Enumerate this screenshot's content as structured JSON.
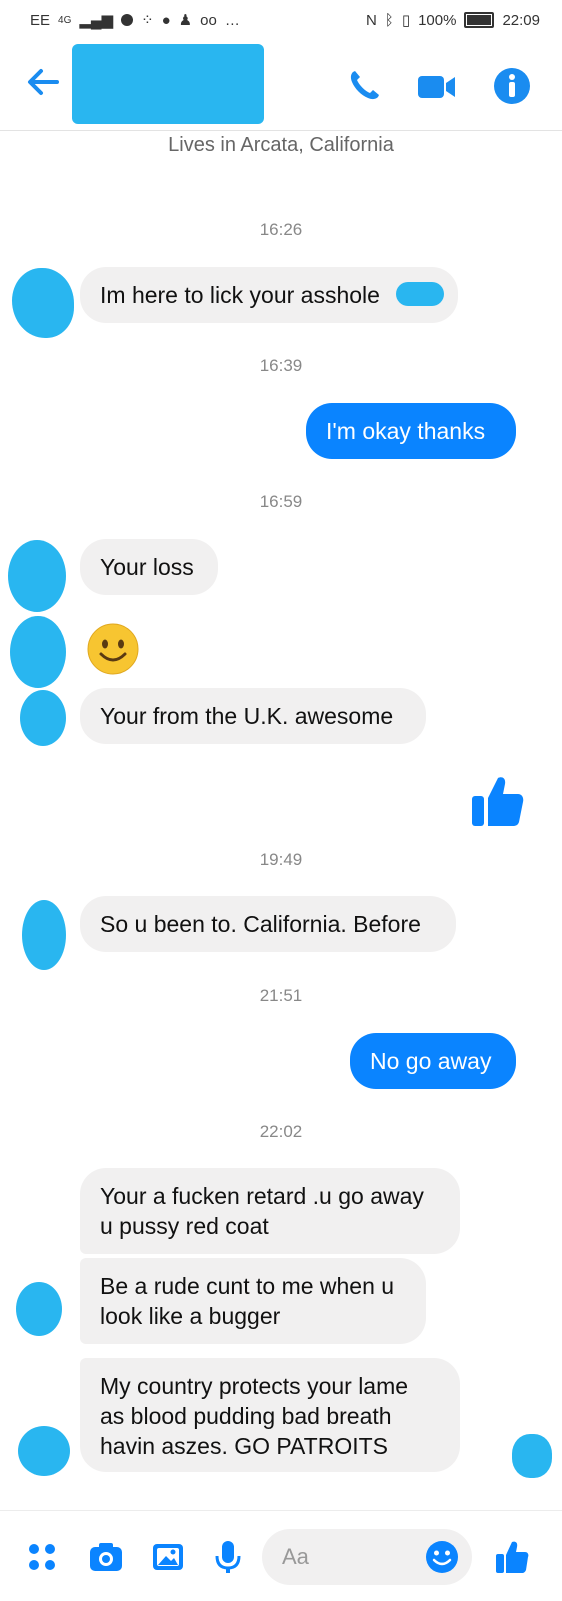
{
  "status_bar": {
    "carrier": "EE",
    "network": "4G",
    "battery": "100%",
    "time": "22:09"
  },
  "header": {
    "back_icon": "arrow-left-icon",
    "call_icon": "phone-icon",
    "video_icon": "video-camera-icon",
    "info_icon": "info-icon",
    "accent": "#1a8cf0"
  },
  "conversation": {
    "lives_in": "Lives in Arcata, California",
    "timestamps": [
      "16:26",
      "16:39",
      "16:59",
      "19:49",
      "21:51",
      "22:02"
    ],
    "messages": [
      {
        "from": "them",
        "text": "Im here to lick your asshole"
      },
      {
        "from": "me",
        "text": "I'm okay thanks"
      },
      {
        "from": "them",
        "text": "Your loss"
      },
      {
        "from": "them",
        "emoji": "smiling-face"
      },
      {
        "from": "them",
        "text": "Your from the U.K. awesome"
      },
      {
        "from": "me",
        "icon": "thumbs-up-icon"
      },
      {
        "from": "them",
        "text": "So u been to. California. Before"
      },
      {
        "from": "me",
        "text": "No go away"
      },
      {
        "from": "them",
        "text": "Your a fucken retard .u go away\nu pussy red coat"
      },
      {
        "from": "them",
        "text": "Be a rude cunt to me when u\nlook like a bugger"
      },
      {
        "from": "them",
        "text": "My country protects your lame\nas blood pudding bad breath\nhavin aszes.  GO PATROITS"
      }
    ],
    "incoming_bubble_color": "#f1f0f0",
    "outgoing_bubble_color": "#0a84ff"
  },
  "composer": {
    "placeholder": "Aa",
    "icons": [
      "apps-icon",
      "camera-icon",
      "image-icon",
      "microphone-icon",
      "emoji-icon",
      "thumbs-up-icon"
    ]
  }
}
